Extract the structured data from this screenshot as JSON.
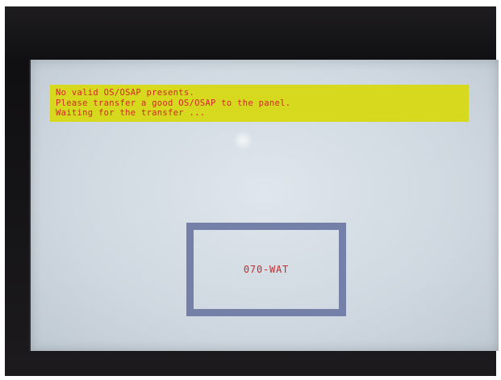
{
  "screen": {
    "messages": [
      "No valid OS/OSAP presents.",
      "Please transfer a good OS/OSAP to the panel.",
      "Waiting for the transfer ..."
    ],
    "device_id": "070-WAT"
  },
  "colors": {
    "banner_background": "#d7d91f",
    "message_text": "#d3262a",
    "box_border": "#7580a9",
    "screen_background": "#dfe6ec"
  }
}
